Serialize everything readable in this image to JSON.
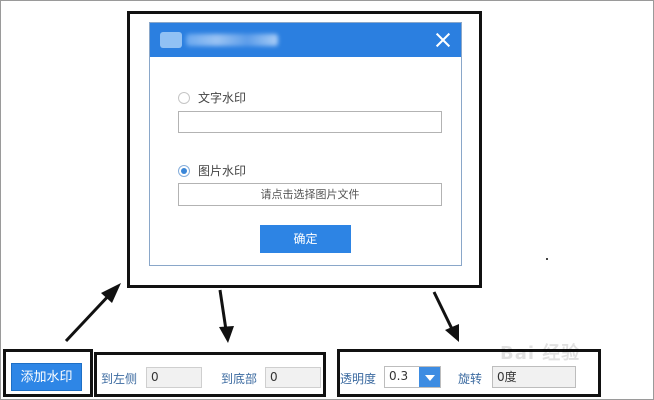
{
  "dialog": {
    "close_glyph": "×",
    "text_watermark_label": "文字水印",
    "text_watermark_value": "",
    "image_watermark_label": "图片水印",
    "pick_image_label": "请点击选择图片文件",
    "confirm_label": "确定"
  },
  "toolbar": {
    "add_watermark_label": "添加水印",
    "to_left_label": "到左侧",
    "to_left_value": "0",
    "to_bottom_label": "到底部",
    "to_bottom_value": "0",
    "opacity_label": "透明度",
    "opacity_value": "0.3",
    "rotate_label": "旋转",
    "rotate_value": "0度"
  },
  "watermark_text": "Bai 经验",
  "colors": {
    "accent": "#2b7fe0",
    "annotation": "#111111"
  },
  "icons": [
    "app-icon",
    "close-icon",
    "chevron-down-icon",
    "arrow-annotation"
  ]
}
